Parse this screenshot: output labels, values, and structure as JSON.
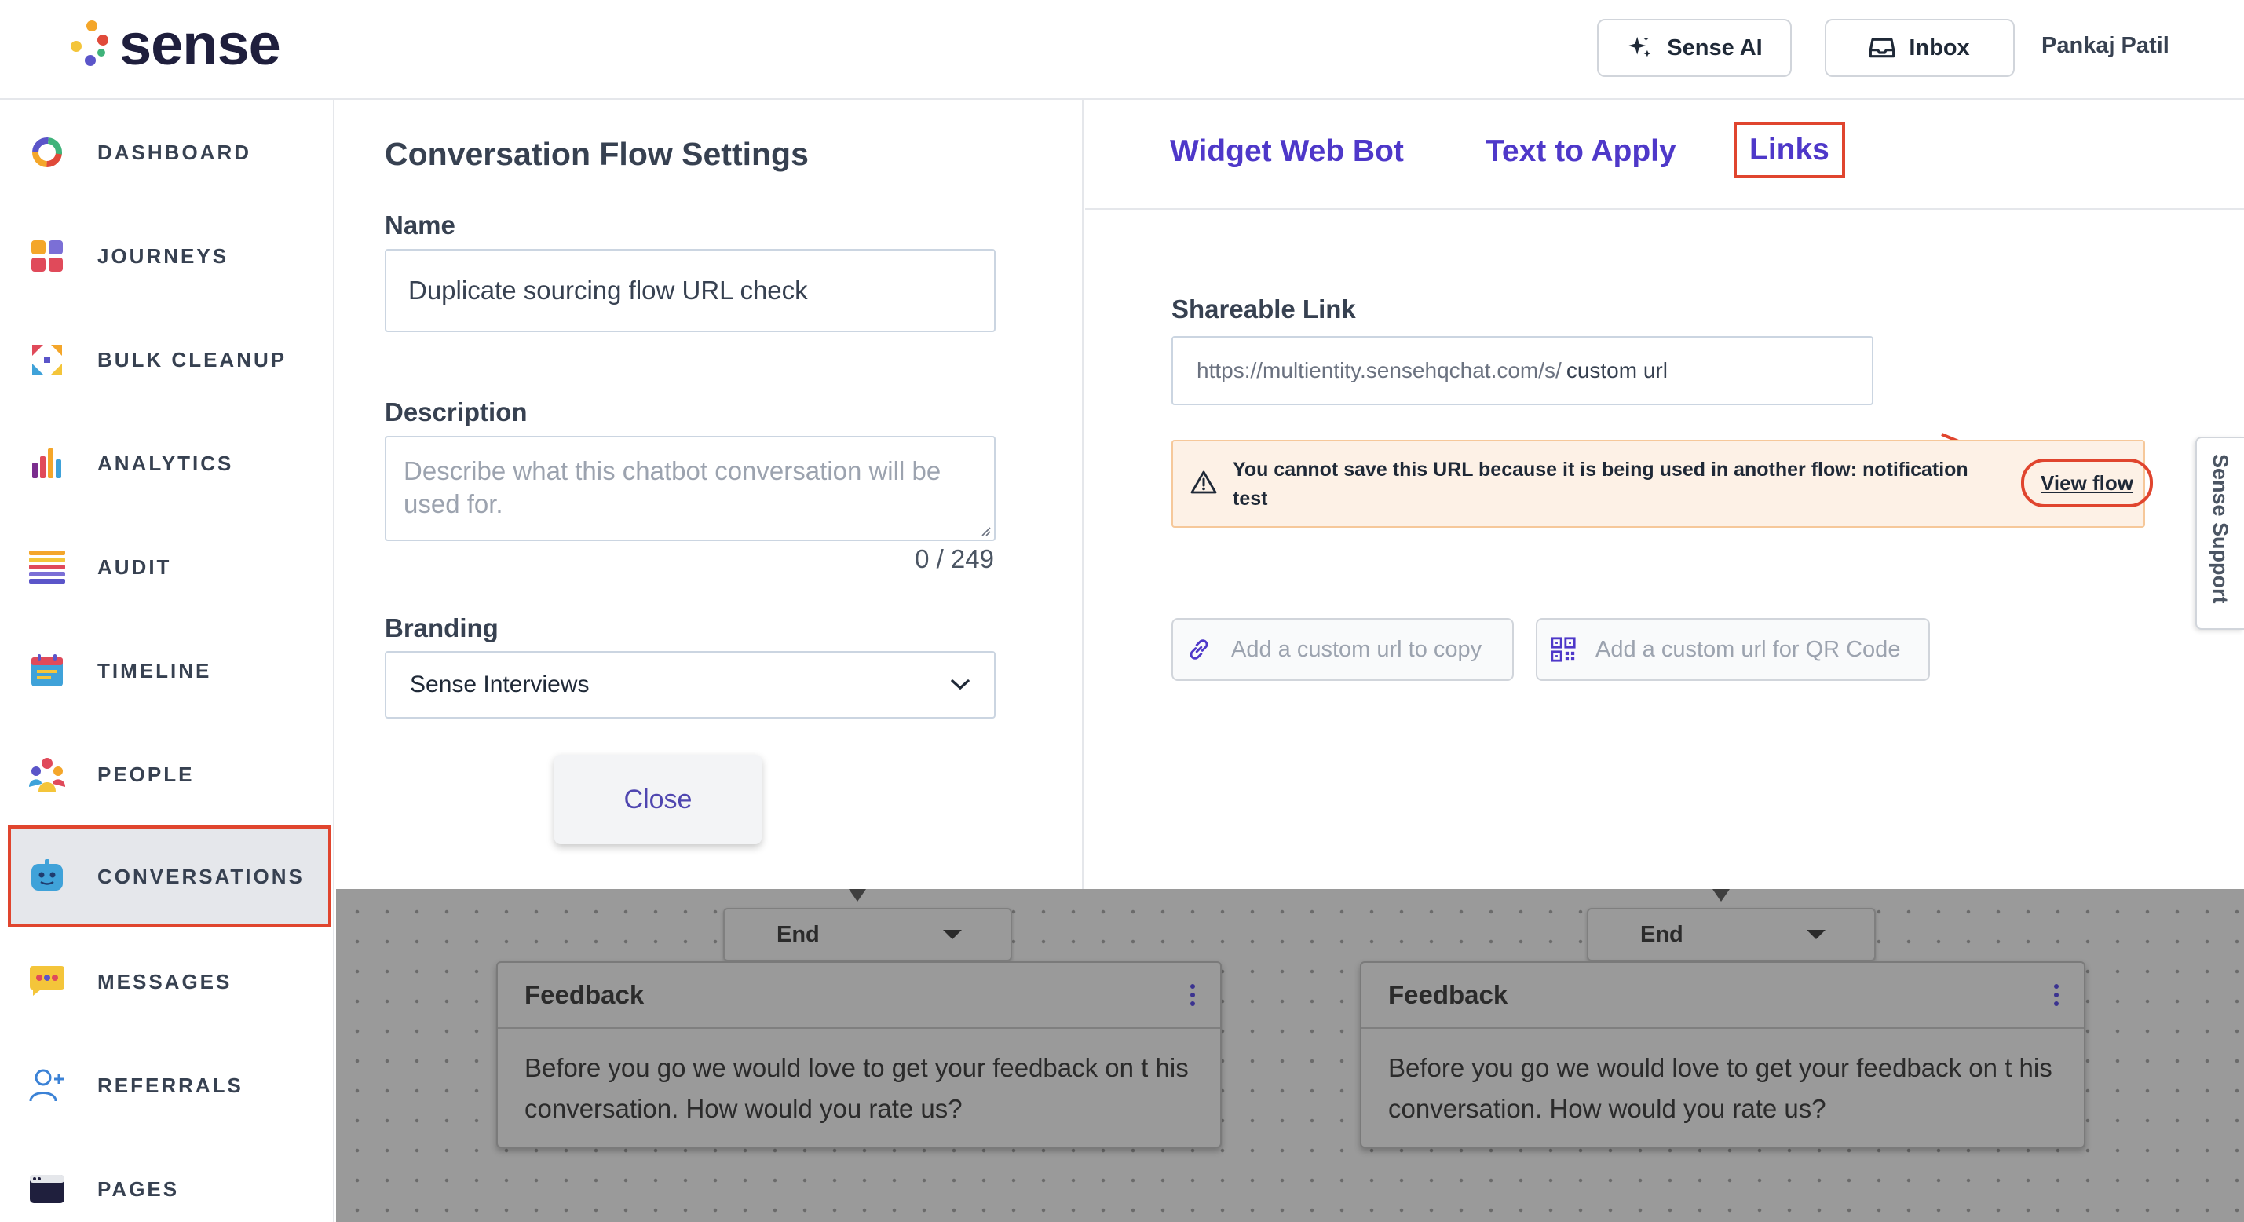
{
  "header": {
    "logo_text": "sense",
    "sense_ai_label": "Sense AI",
    "inbox_label": "Inbox",
    "user_name": "Pankaj Patil"
  },
  "sidebar": {
    "items": [
      {
        "label": "DASHBOARD",
        "icon": "dashboard-icon"
      },
      {
        "label": "JOURNEYS",
        "icon": "journeys-icon"
      },
      {
        "label": "BULK CLEANUP",
        "icon": "bulk-cleanup-icon"
      },
      {
        "label": "ANALYTICS",
        "icon": "analytics-icon"
      },
      {
        "label": "AUDIT",
        "icon": "audit-icon"
      },
      {
        "label": "TIMELINE",
        "icon": "timeline-icon"
      },
      {
        "label": "PEOPLE",
        "icon": "people-icon"
      },
      {
        "label": "CONVERSATIONS",
        "icon": "conversations-icon",
        "active": true
      },
      {
        "label": "MESSAGES",
        "icon": "messages-icon"
      },
      {
        "label": "REFERRALS",
        "icon": "referrals-icon"
      },
      {
        "label": "PAGES",
        "icon": "pages-icon"
      }
    ]
  },
  "settings": {
    "title": "Conversation Flow Settings",
    "name_label": "Name",
    "name_value": "Duplicate sourcing flow URL check",
    "description_label": "Description",
    "description_placeholder": "Describe what this chatbot conversation will be used for.",
    "description_counter": "0 / 249",
    "branding_label": "Branding",
    "branding_value": "Sense Interviews",
    "close_label": "Close"
  },
  "links_panel": {
    "tabs": [
      "Widget Web Bot",
      "Text to Apply",
      "Links"
    ],
    "active_tab": "Links",
    "shareable_label": "Shareable Link",
    "url_prefix": "https://multientity.sensehqchat.com/s/",
    "url_custom": "custom url",
    "warning_text": "You cannot save this URL because it is being used in another flow: notification test",
    "view_flow_label": "View flow",
    "copy_placeholder": "Add a custom url to copy",
    "qr_placeholder": "Add a custom url for QR Code",
    "support_label": "Sense Support"
  },
  "canvas": {
    "nodes": [
      {
        "select_label": "End",
        "title": "Feedback",
        "body": "Before you go we would love to get your feedback on t his conversation. How would you rate us?"
      },
      {
        "select_label": "End",
        "title": "Feedback",
        "body": "Before you go we would love to get your feedback on t his conversation. How would you rate us?"
      }
    ]
  },
  "colors": {
    "accent": "#4e38c9",
    "highlight": "#e0452e",
    "warning_bg": "#fdf1e6"
  }
}
